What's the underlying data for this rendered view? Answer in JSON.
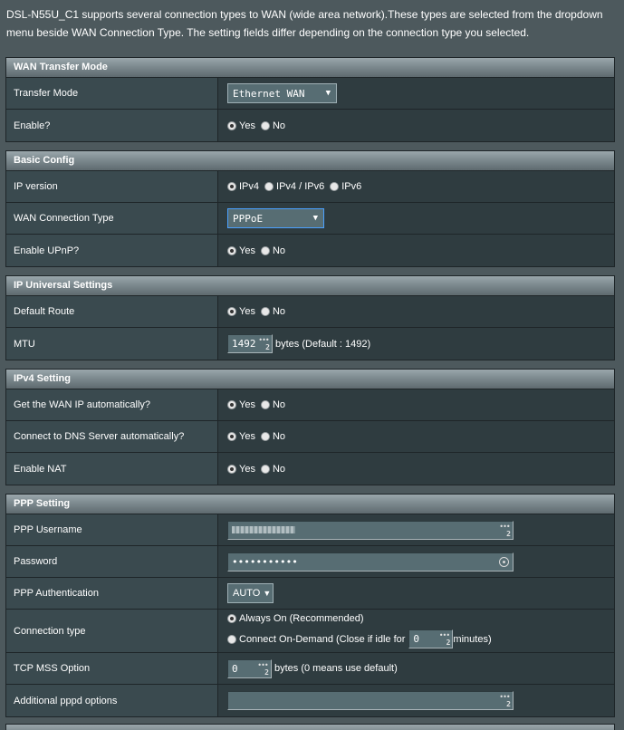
{
  "intro": "DSL-N55U_C1 supports several connection types to WAN (wide area network).These types are selected from the dropdown menu beside WAN Connection Type. The setting fields differ depending on the connection type you selected.",
  "wan_transfer": {
    "title": "WAN Transfer Mode",
    "transfer_mode_label": "Transfer Mode",
    "transfer_mode_value": "Ethernet WAN",
    "enable_label": "Enable?",
    "yes": "Yes",
    "no": "No"
  },
  "basic": {
    "title": "Basic Config",
    "ip_version_label": "IP version",
    "ipv4": "IPv4",
    "ipv46": "IPv4 / IPv6",
    "ipv6": "IPv6",
    "wan_type_label": "WAN Connection Type",
    "wan_type_value": "PPPoE",
    "upnp_label": "Enable UPnP?",
    "yes": "Yes",
    "no": "No"
  },
  "ip_universal": {
    "title": "IP Universal Settings",
    "default_route_label": "Default Route",
    "mtu_label": "MTU",
    "mtu_value": "1492",
    "mtu_suffix": "bytes (Default : 1492)",
    "yes": "Yes",
    "no": "No"
  },
  "ipv4": {
    "title": "IPv4 Setting",
    "wan_ip_auto_label": "Get the WAN IP automatically?",
    "dns_auto_label": "Connect to DNS Server automatically?",
    "nat_label": "Enable NAT",
    "yes": "Yes",
    "no": "No"
  },
  "ppp": {
    "title": "PPP Setting",
    "username_label": "PPP Username",
    "password_label": "Password",
    "password_value": "•••••••••••",
    "auth_label": "PPP Authentication",
    "auth_value": "AUTO",
    "conn_type_label": "Connection type",
    "always_on": "Always On (Recommended)",
    "on_demand": "Connect On-Demand (Close if idle for",
    "idle_value": "0",
    "idle_suffix": "minutes)",
    "tcp_mss_label": "TCP MSS Option",
    "tcp_mss_value": "0",
    "tcp_mss_suffix": "bytes (0 means use default)",
    "pppd_label": "Additional pppd options"
  },
  "kbd_badge": "2",
  "icons": {
    "kbd": "keyboard-dots-icon",
    "eye": "eye-icon",
    "caret": "dropdown-caret-icon"
  }
}
